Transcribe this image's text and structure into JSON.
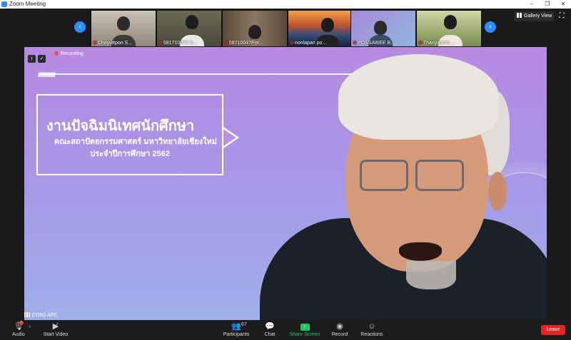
{
  "window": {
    "title": "Zoom Meeting"
  },
  "window_controls": {
    "minimize": "–",
    "maximize": "❐",
    "close": "✕"
  },
  "gallery_nav": {
    "prev": "‹",
    "next": "›"
  },
  "participants": [
    {
      "name": "Chayuttpon S..."
    },
    {
      "name": "581710074 S..."
    },
    {
      "name": "58710047Por..."
    },
    {
      "name": "nonlapan po..."
    },
    {
      "name": "POSSAWEE B..."
    },
    {
      "name": "Thanyaporn ..."
    }
  ],
  "view": {
    "gallery_label": "Gallery View",
    "fullscreen_icon": "⛶"
  },
  "recording": {
    "label": "Recording"
  },
  "slide": {
    "heading": "งานปัจฉิมนิเทศนักศึกษา",
    "subheading": "คณะสถาปัตยกรรมศาสตร์ มหาวิทยาลัยเชียงใหม่",
    "year_line": "ประจำปีการศึกษา 2562",
    "stripes": "////////////////"
  },
  "speaker": {
    "network_label": "CON2 ARC"
  },
  "toolbar": {
    "audio": "Audio",
    "start_video": "Start Video",
    "participants": "Participants",
    "participants_count": "67",
    "chat": "Chat",
    "share_screen": "Share Screen",
    "record": "Record",
    "reactions": "Reactions",
    "leave": "Leave",
    "audio_badge": "!"
  },
  "colors": {
    "accent": "#2d8cff",
    "leave": "#e02828",
    "share": "#27c268"
  }
}
